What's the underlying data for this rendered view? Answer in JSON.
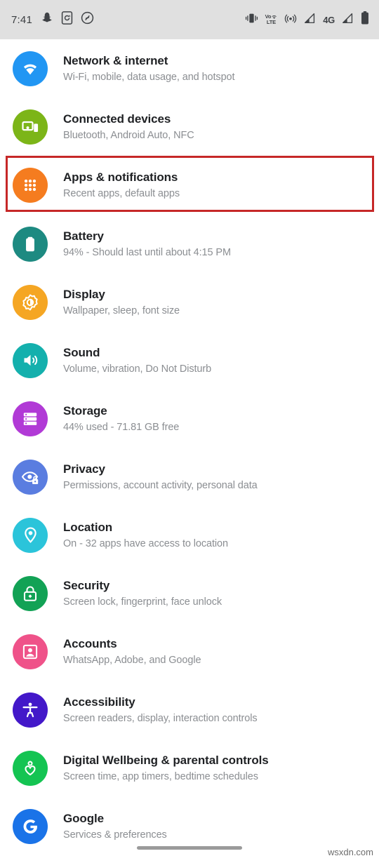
{
  "status_bar": {
    "time": "7:41",
    "left_icons": [
      "snapchat-icon",
      "screen-record-icon",
      "shazam-icon"
    ],
    "right_icons": [
      "vibrate-icon",
      "volte-icon",
      "hotspot-icon",
      "signal-icon",
      "network-4g-icon",
      "signal-icon",
      "battery-icon"
    ],
    "volte_top": "Vo",
    "volte_bottom": "LTE",
    "network_label": "4G"
  },
  "highlight": {
    "target": "Apps & notifications",
    "color": "#c62828"
  },
  "settings": {
    "items": [
      {
        "id": "network-internet",
        "title": "Network & internet",
        "subtitle": "Wi-Fi, mobile, data usage, and hotspot",
        "icon": "wifi-icon",
        "color": "#2196f3",
        "highlighted": false
      },
      {
        "id": "connected-devices",
        "title": "Connected devices",
        "subtitle": "Bluetooth, Android Auto, NFC",
        "icon": "devices-icon",
        "color": "#7cb518",
        "highlighted": false
      },
      {
        "id": "apps-notifications",
        "title": "Apps & notifications",
        "subtitle": "Recent apps, default apps",
        "icon": "apps-grid-icon",
        "color": "#f57c1f",
        "highlighted": true
      },
      {
        "id": "battery",
        "title": "Battery",
        "subtitle": "94% - Should last until about 4:15 PM",
        "icon": "battery-icon",
        "color": "#1d8a81",
        "highlighted": false
      },
      {
        "id": "display",
        "title": "Display",
        "subtitle": "Wallpaper, sleep, font size",
        "icon": "brightness-icon",
        "color": "#f5a623",
        "highlighted": false
      },
      {
        "id": "sound",
        "title": "Sound",
        "subtitle": "Volume, vibration, Do Not Disturb",
        "icon": "volume-icon",
        "color": "#14b0ad",
        "highlighted": false
      },
      {
        "id": "storage",
        "title": "Storage",
        "subtitle": "44% used - 71.81 GB free",
        "icon": "storage-icon",
        "color": "#b13ad6",
        "highlighted": false
      },
      {
        "id": "privacy",
        "title": "Privacy",
        "subtitle": "Permissions, account activity, personal data",
        "icon": "privacy-eye-icon",
        "color": "#5a7de0",
        "highlighted": false
      },
      {
        "id": "location",
        "title": "Location",
        "subtitle": "On - 32 apps have access to location",
        "icon": "location-pin-icon",
        "color": "#2bc4da",
        "highlighted": false
      },
      {
        "id": "security",
        "title": "Security",
        "subtitle": "Screen lock, fingerprint, face unlock",
        "icon": "lock-icon",
        "color": "#12a255",
        "highlighted": false
      },
      {
        "id": "accounts",
        "title": "Accounts",
        "subtitle": "WhatsApp, Adobe, and Google",
        "icon": "account-icon",
        "color": "#ef5289",
        "highlighted": false
      },
      {
        "id": "accessibility",
        "title": "Accessibility",
        "subtitle": "Screen readers, display, interaction controls",
        "icon": "accessibility-icon",
        "color": "#4318c9",
        "highlighted": false
      },
      {
        "id": "digital-wellbeing",
        "title": "Digital Wellbeing & parental controls",
        "subtitle": "Screen time, app timers, bedtime schedules",
        "icon": "wellbeing-icon",
        "color": "#14c452",
        "highlighted": false
      },
      {
        "id": "google",
        "title": "Google",
        "subtitle": "Services & preferences",
        "icon": "google-g-icon",
        "color": "#1a73e8",
        "highlighted": false
      }
    ]
  },
  "navigation": {
    "gesture_pill": "home-gesture-pill"
  },
  "watermark": {
    "text": "wsxdn.com"
  }
}
